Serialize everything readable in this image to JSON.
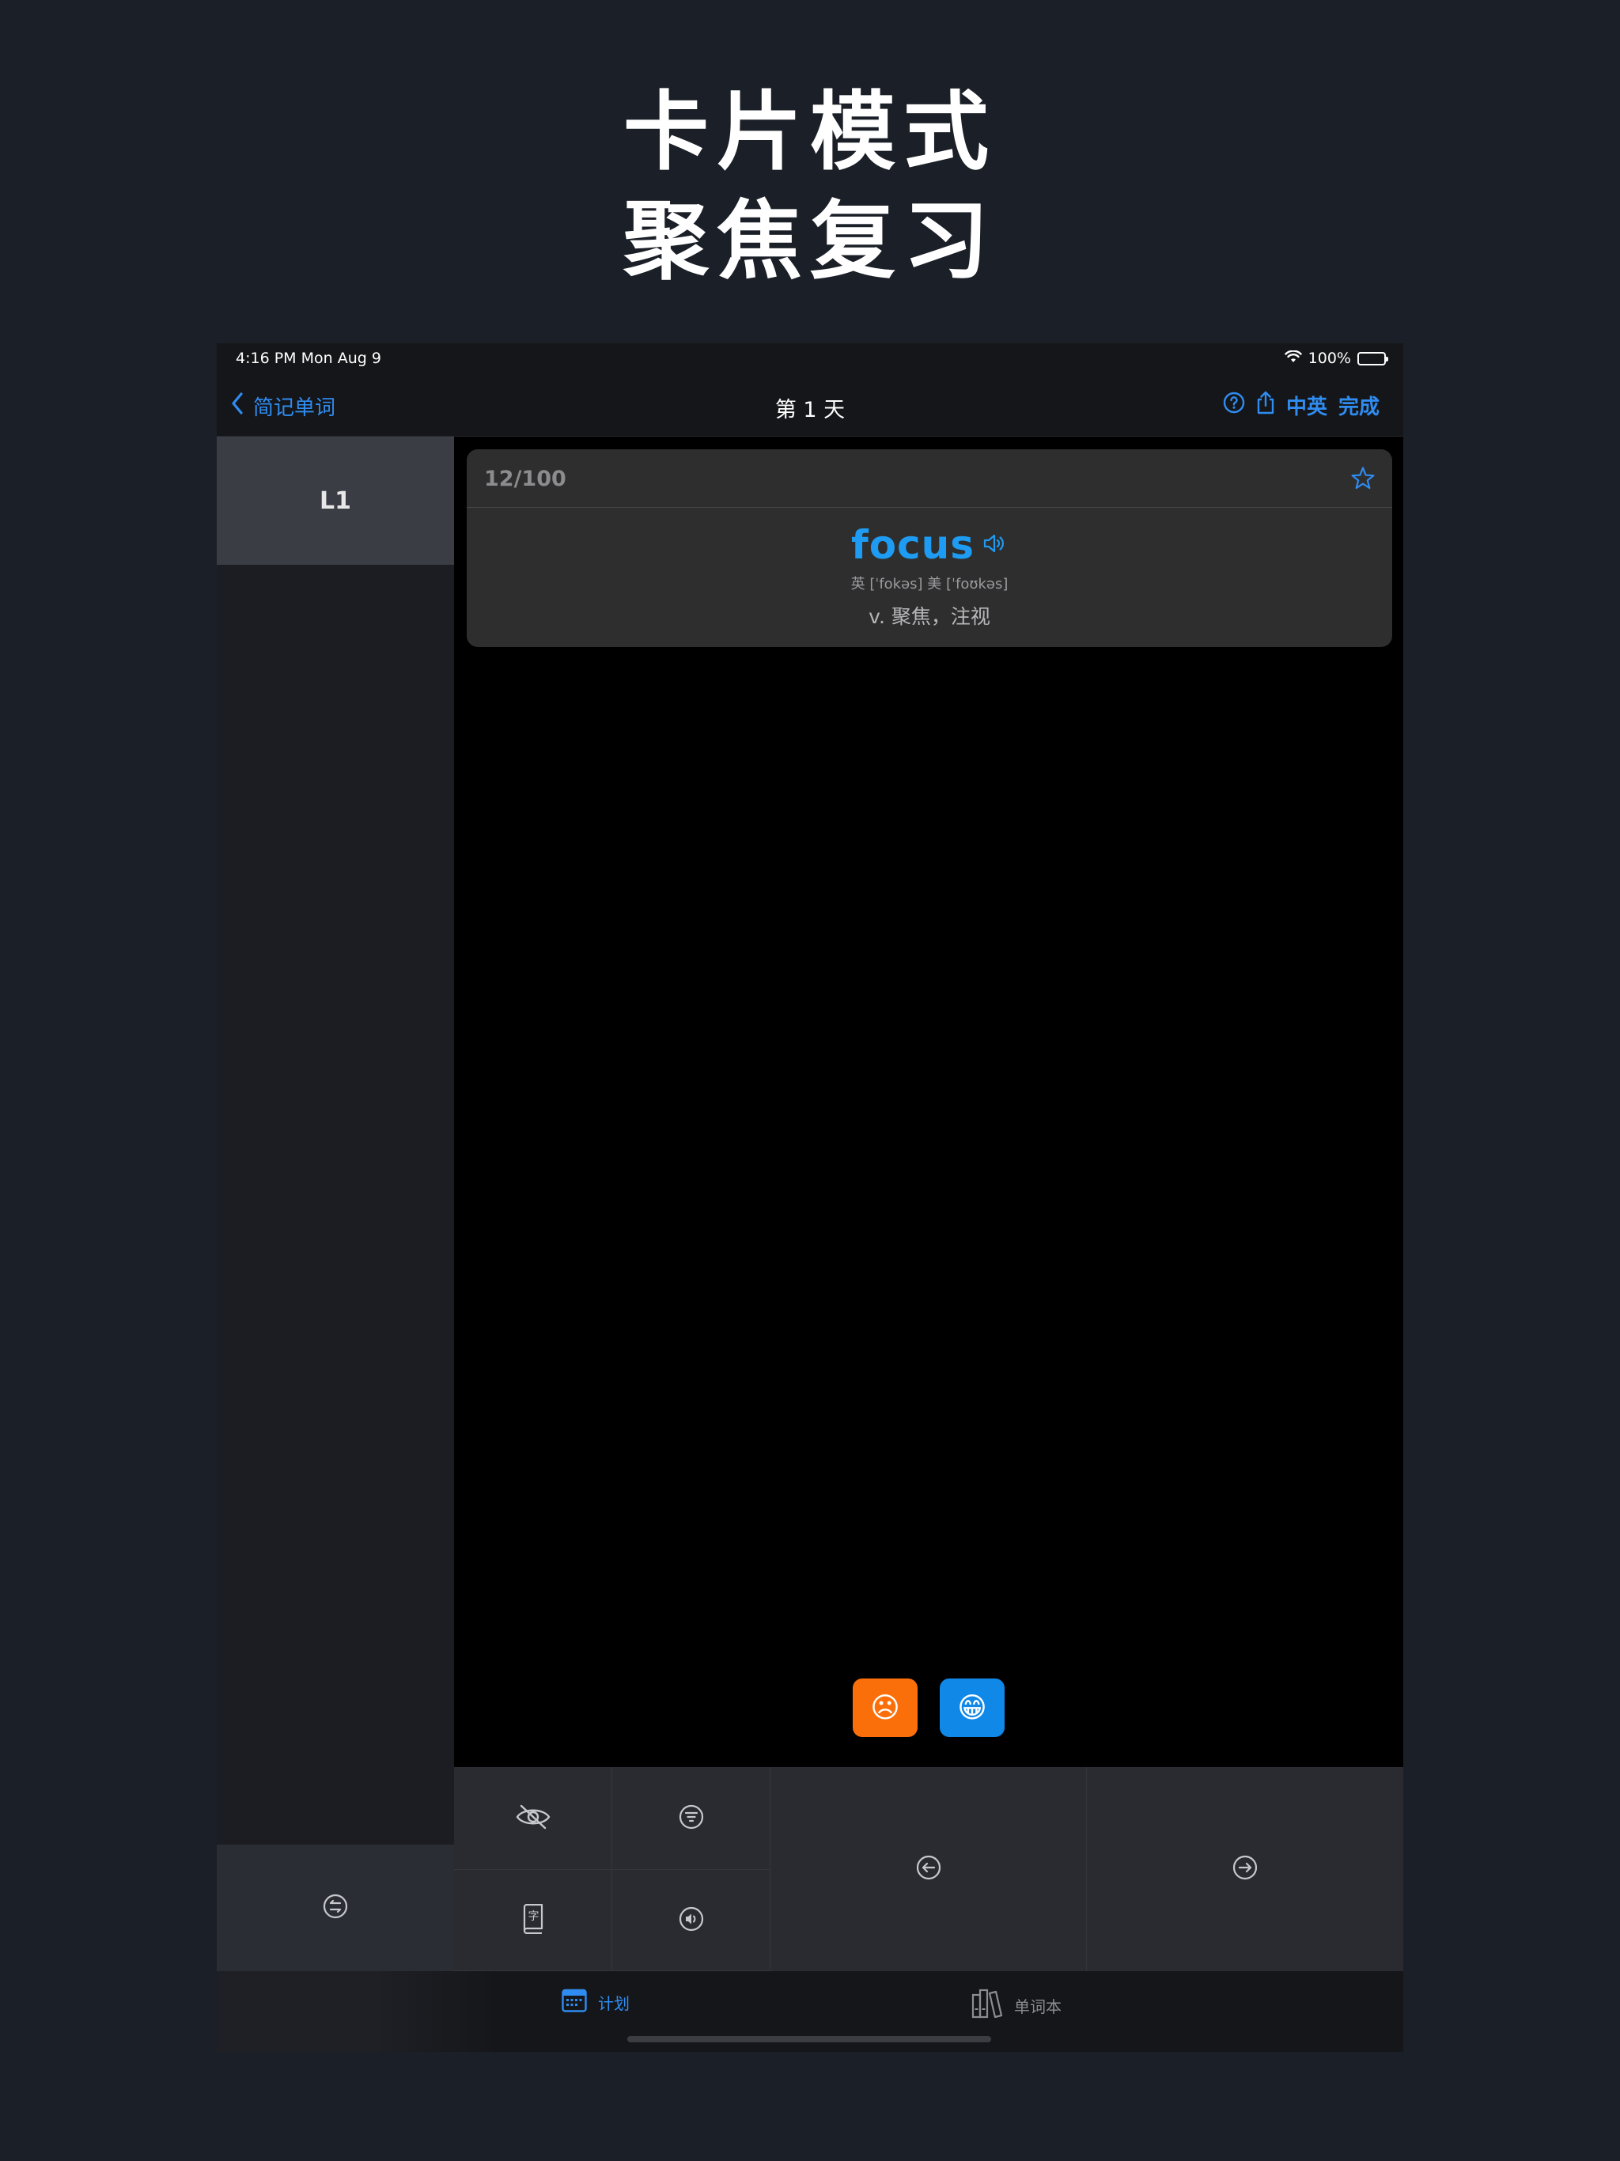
{
  "promo": {
    "headline_line1": "卡片模式",
    "headline_line2": "聚焦复习"
  },
  "status_bar": {
    "time": "4:16 PM   Mon Aug 9",
    "battery": "100%"
  },
  "nav": {
    "back_label": "简记单词",
    "title": "第 1 天",
    "lang_toggle": "中英",
    "done_label": "完成"
  },
  "sidebar": {
    "lesson_label": "L1"
  },
  "card": {
    "counter": "12/100",
    "word": "focus",
    "phonetic": "英 [ˈfokəs] 美 [ˈfoʊkəs]",
    "meaning": "v. 聚焦，注视"
  },
  "rating": {
    "hard_emoji": "☹",
    "easy_emoji": "😁"
  },
  "tabbar": {
    "plan_label": "计划",
    "wordbook_label": "单词本"
  },
  "icons": {
    "accent": "#2f8cf0",
    "word_color": "#1e9bf2",
    "hard_color": "#fa6f0a",
    "easy_color": "#1088e8"
  }
}
